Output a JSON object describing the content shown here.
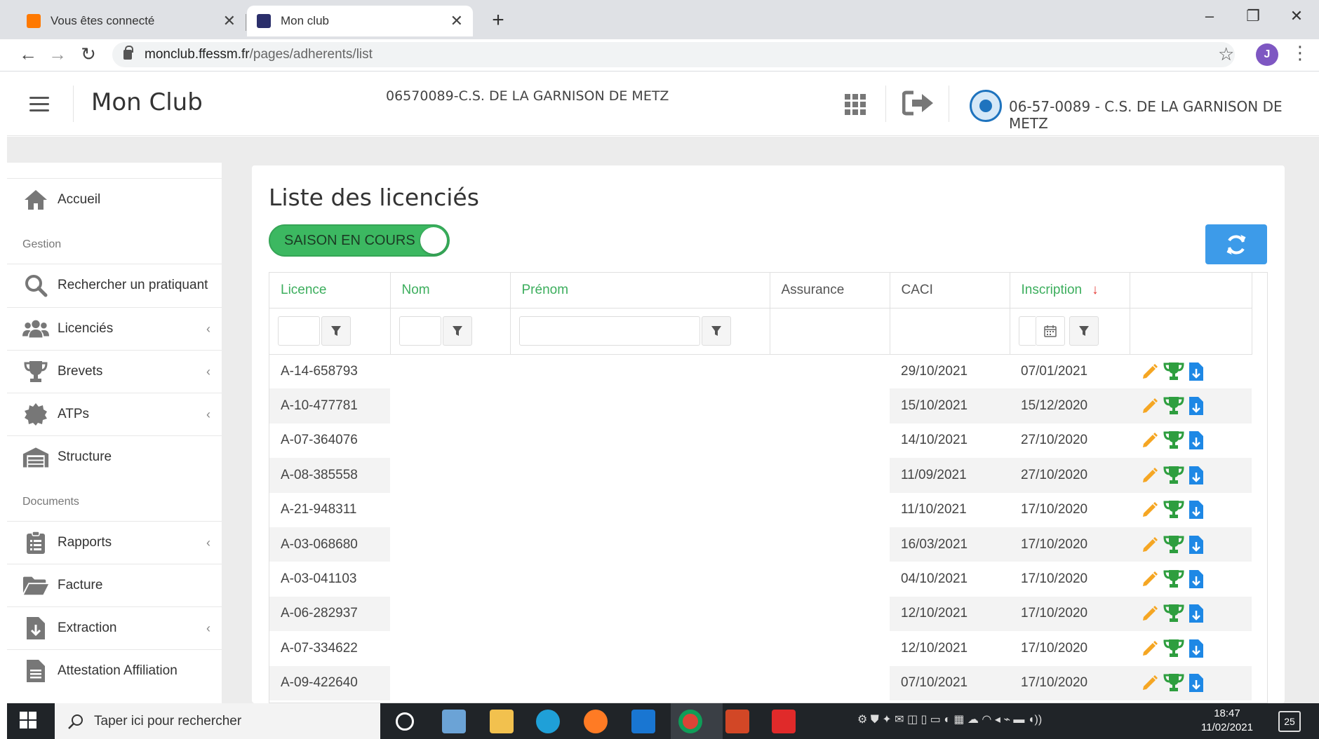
{
  "browser": {
    "tabs": [
      {
        "title": "Vous êtes connecté",
        "favicon_color": "#ff7900"
      },
      {
        "title": "Mon club",
        "favicon_color": "#2b2f6b"
      }
    ],
    "url_host": "monclub.ffessm.fr",
    "url_path": "/pages/adherents/list",
    "profile_initial": "J"
  },
  "header": {
    "app_title": "Mon Club",
    "club_center": "06570089-C.S. DE LA GARNISON DE METZ",
    "club_right": "06-57-0089 - C.S. DE LA GARNISON DE METZ"
  },
  "sidebar": {
    "items": [
      {
        "label": "Accueil",
        "icon": "home-icon"
      },
      {
        "label": "Rechercher un pratiquant",
        "icon": "search-icon"
      },
      {
        "label": "Licenciés",
        "icon": "users-icon",
        "expandable": true
      },
      {
        "label": "Brevets",
        "icon": "trophy-icon",
        "expandable": true
      },
      {
        "label": "ATPs",
        "icon": "gear-badge-icon",
        "expandable": true
      },
      {
        "label": "Structure",
        "icon": "warehouse-icon"
      },
      {
        "label": "Rapports",
        "icon": "clipboard-icon",
        "expandable": true
      },
      {
        "label": "Facture",
        "icon": "folder-icon"
      },
      {
        "label": "Extraction",
        "icon": "download-file-icon",
        "expandable": true
      },
      {
        "label": "Attestation Affiliation",
        "icon": "document-icon"
      }
    ],
    "sections": [
      "Gestion",
      "Documents"
    ]
  },
  "main": {
    "title": "Liste des licenciés",
    "toggle_label": "SAISON EN COURS",
    "toggle_on": true,
    "columns": [
      "Licence",
      "Nom",
      "Prénom",
      "Assurance",
      "CACI",
      "Inscription"
    ],
    "sort_arrow": "↓",
    "rows": [
      {
        "licence": "A-14-658793",
        "caci": "29/10/2021",
        "inscription": "07/01/2021"
      },
      {
        "licence": "A-10-477781",
        "caci": "15/10/2021",
        "inscription": "15/12/2020"
      },
      {
        "licence": "A-07-364076",
        "caci": "14/10/2021",
        "inscription": "27/10/2020"
      },
      {
        "licence": "A-08-385558",
        "caci": "11/09/2021",
        "inscription": "27/10/2020"
      },
      {
        "licence": "A-21-948311",
        "caci": "11/10/2021",
        "inscription": "17/10/2020"
      },
      {
        "licence": "A-03-068680",
        "caci": "16/03/2021",
        "inscription": "17/10/2020"
      },
      {
        "licence": "A-03-041103",
        "caci": "04/10/2021",
        "inscription": "17/10/2020"
      },
      {
        "licence": "A-06-282937",
        "caci": "12/10/2021",
        "inscription": "17/10/2020"
      },
      {
        "licence": "A-07-334622",
        "caci": "12/10/2021",
        "inscription": "17/10/2020"
      },
      {
        "licence": "A-09-422640",
        "caci": "07/10/2021",
        "inscription": "17/10/2020"
      }
    ]
  },
  "taskbar": {
    "search_placeholder": "Taper ici pour rechercher",
    "time": "18:47",
    "date": "11/02/2021",
    "notification_count": "25"
  },
  "colors": {
    "accent_green": "#3cae5d",
    "toggle_green": "#3cb861",
    "refresh_blue": "#3d9be9",
    "sort_red": "#e53935",
    "edit_orange": "#f5a623",
    "trophy_green": "#2e9e3f",
    "download_blue": "#1e88e5"
  }
}
